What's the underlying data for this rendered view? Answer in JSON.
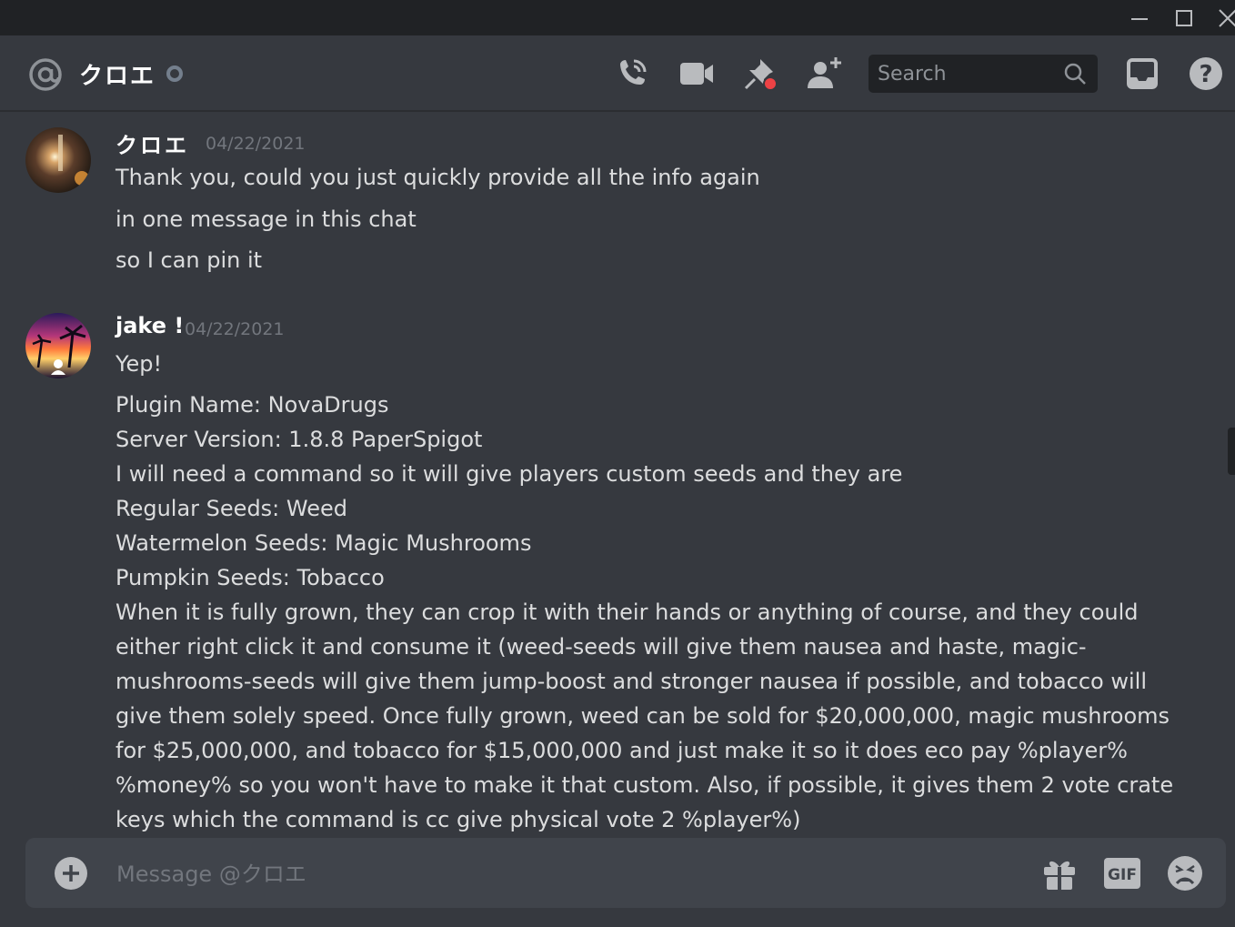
{
  "window": {
    "minimize_icon": "minimize-icon",
    "maximize_icon": "maximize-icon",
    "close_icon": "close-icon"
  },
  "header": {
    "channel_name": "クロエ",
    "status": "offline",
    "search_placeholder": "Search",
    "icons": [
      "at-icon",
      "voice-call-icon",
      "video-call-icon",
      "pinned-messages-icon",
      "add-friend-icon",
      "search-icon",
      "inbox-icon",
      "help-icon"
    ]
  },
  "messages": [
    {
      "author": "クロエ",
      "timestamp": "04/22/2021",
      "lines": [
        "Thank you, could you just quickly provide all the info again",
        "in one message in this chat",
        "so I can pin it"
      ]
    },
    {
      "author": "jake !",
      "timestamp": "04/22/2021",
      "lines": [
        "Yep!",
        "Plugin Name: NovaDrugs",
        "Server Version: 1.8.8 PaperSpigot",
        "I will need a command so it will give players custom seeds and they are",
        "Regular Seeds: Weed",
        "Watermelon Seeds: Magic Mushrooms",
        "Pumpkin Seeds: Tobacco",
        "When it is fully grown, they can crop it with their hands or anything of course, and they could",
        "either right click it and consume it (weed-seeds will give them nausea and haste, magic-",
        "mushrooms-seeds will give them jump-boost and stronger nausea if possible, and tobacco will",
        "give them solely speed. Once fully grown, weed can be sold for $20,000,000, magic mushrooms",
        "for $25,000,000, and tobacco for $15,000,000 and just make it so it does eco pay %player%",
        "%money% so you won't have to make it that custom. Also, if possible, it gives them 2 vote crate",
        "keys which the command is cc give physical vote 2 %player%)"
      ]
    }
  ],
  "composer": {
    "placeholder": "Message @クロエ",
    "icons": [
      "add-attachment-icon",
      "gift-icon",
      "gif-icon",
      "emoji-icon"
    ],
    "gif_label": "GIF"
  },
  "colors": {
    "background": "#36393f",
    "titlebar": "#202225",
    "input": "#40444b",
    "text": "#dcddde",
    "muted": "#72767d",
    "badge_red": "#ed4245"
  }
}
